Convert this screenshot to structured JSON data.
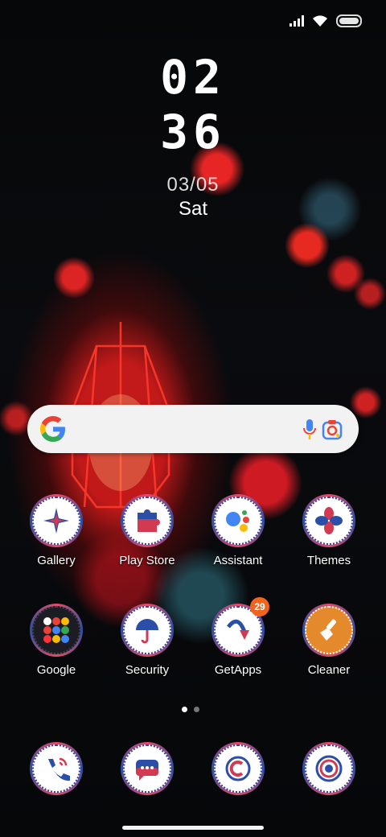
{
  "status_bar": {
    "icons": [
      "signal-icon",
      "wifi-icon",
      "battery-icon"
    ]
  },
  "clock": {
    "hour": "02",
    "minute": "36",
    "date": "03/05",
    "day": "Sat"
  },
  "search": {
    "icons": [
      "google-g-icon",
      "mic-icon",
      "lens-icon"
    ]
  },
  "apps": {
    "row1": [
      {
        "label": "Gallery",
        "icon": "gallery-icon"
      },
      {
        "label": "Play Store",
        "icon": "play-store-icon"
      },
      {
        "label": "Assistant",
        "icon": "assistant-icon"
      },
      {
        "label": "Themes",
        "icon": "themes-icon"
      }
    ],
    "row2": [
      {
        "label": "Google",
        "icon": "google-folder-icon"
      },
      {
        "label": "Security",
        "icon": "security-icon"
      },
      {
        "label": "GetApps",
        "icon": "getapps-icon",
        "badge": "29"
      },
      {
        "label": "Cleaner",
        "icon": "cleaner-icon"
      }
    ]
  },
  "dock": [
    {
      "icon": "phone-icon"
    },
    {
      "icon": "messages-icon"
    },
    {
      "icon": "browser-icon"
    },
    {
      "icon": "camera-icon"
    }
  ],
  "pages": {
    "count": 2,
    "active": 1
  },
  "colors": {
    "accent_badge": "#f0641e",
    "icon_ring_red": "#e24b6b",
    "icon_ring_blue": "#2b4fa8"
  }
}
